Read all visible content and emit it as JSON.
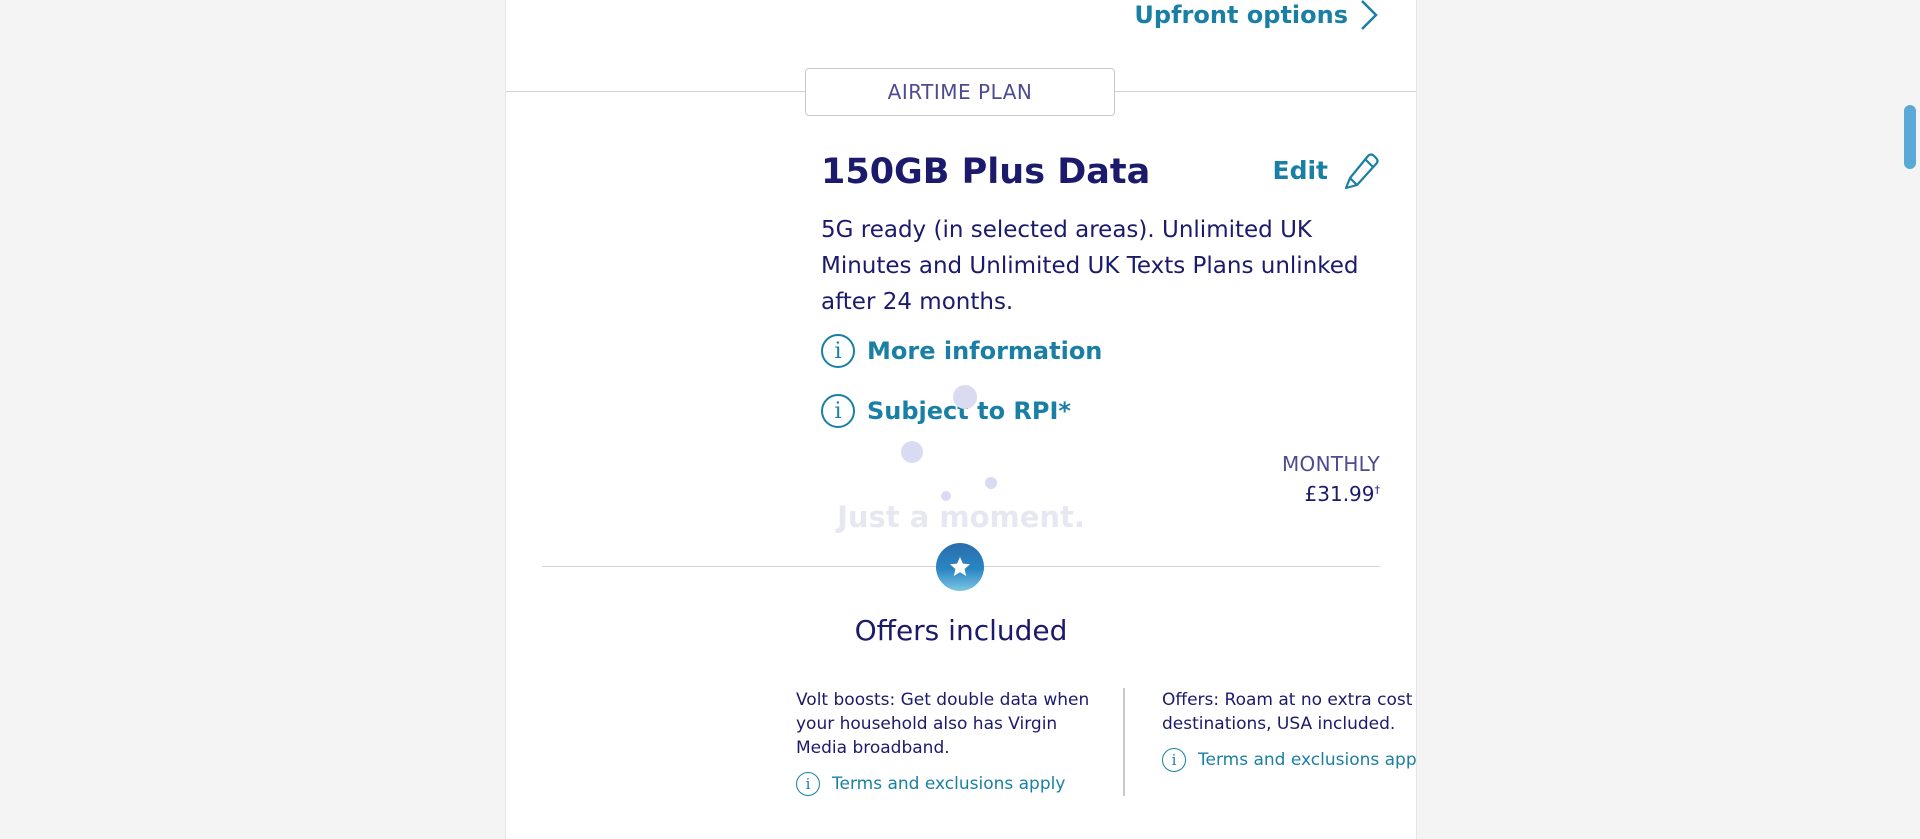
{
  "header": {
    "upfront_label": "Upfront options",
    "chevron_icon": "chevron-right-icon"
  },
  "plan": {
    "tag": "AIRTIME PLAN",
    "title": "150GB Plus Data",
    "edit_label": "Edit",
    "edit_icon": "pencil-icon",
    "description": "5G ready (in selected areas). Unlimited UK Minutes and Unlimited UK Texts Plans unlinked after 24 months.",
    "more_info_label": "More information",
    "rpi_label": "Subject to RPI*",
    "info_icon_glyph": "i",
    "price_label": "MONTHLY",
    "price_value": "£31.99",
    "price_marker": "†"
  },
  "loader": {
    "text": "Just a moment."
  },
  "offers": {
    "badge_icon": "star-icon",
    "title": "Offers included",
    "items": [
      {
        "text": "Volt boosts: Get double data when your household also has Virgin Media broadband.",
        "terms_label": "Terms and exclusions apply"
      },
      {
        "text": "Offers: Roam at no extra cost in destinations, USA included.",
        "terms_label": "Terms and exclusions apply"
      }
    ]
  },
  "colors": {
    "link": "#1a7fa4",
    "text": "#1b1a6b",
    "muted": "#4c4c8f",
    "badge": "#2a6dae"
  }
}
